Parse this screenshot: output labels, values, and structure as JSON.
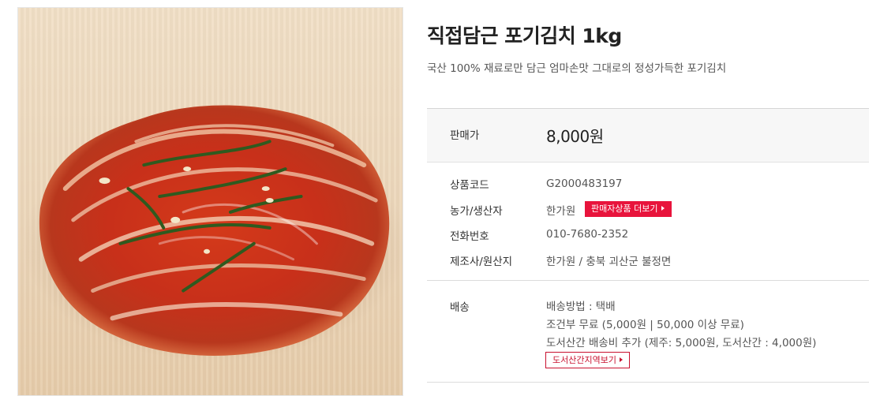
{
  "product": {
    "title": "직접담근 포기김치 1kg",
    "subtitle": "국산 100% 재료로만 담근 엄마손맛 그대로의 정성가득한 포기김치",
    "image_alt": "포기김치"
  },
  "price": {
    "label": "판매가",
    "value": "8,000원"
  },
  "details": {
    "code_label": "상품코드",
    "code_value": "G2000483197",
    "farm_label": "농가/생산자",
    "farm_value": "한가원",
    "seller_more_label": "판매자상품 더보기",
    "phone_label": "전화번호",
    "phone_value": "010-7680-2352",
    "origin_label": "제조사/원산지",
    "origin_value": "한가원 / 충북 괴산군 불정면"
  },
  "shipping": {
    "label": "배송",
    "method": "배송방법 : 택배",
    "condition": "조건부 무료 (5,000원 | 50,000 이상 무료)",
    "extra": "도서산간 배송비 추가 (제주: 5,000원, 도서산간 : 4,000원)",
    "region_button_label": "도서산간지역보기"
  },
  "colors": {
    "accent_red": "#e8143c",
    "outline_red": "#c8102e",
    "price_bg": "#f7f7f7"
  }
}
